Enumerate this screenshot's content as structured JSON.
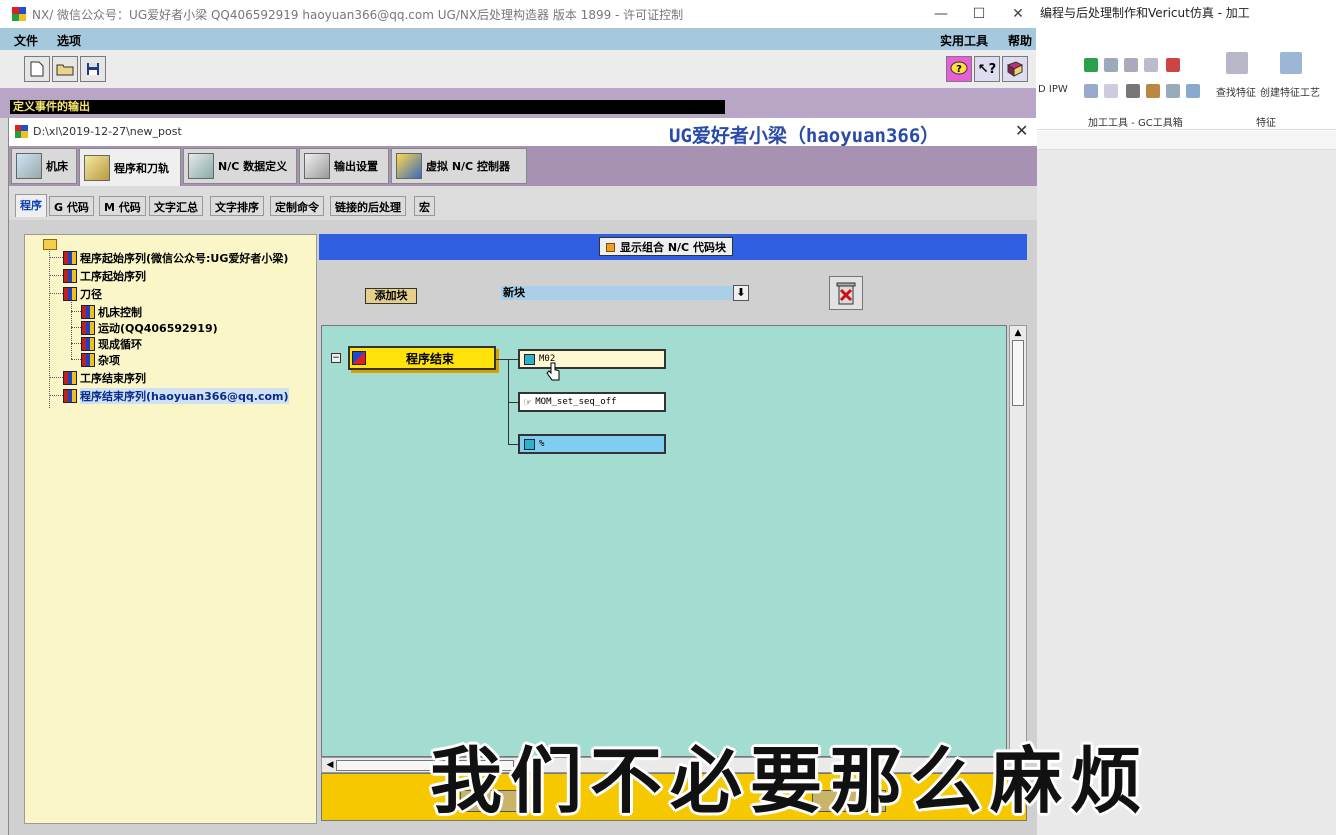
{
  "window": {
    "title": "NX/   微信公众号：UG爱好者小梁  QQ406592919  haoyuan366@qq.com  UG/NX后处理构造器 版本 1899 - 许可证控制",
    "min": "—",
    "max": "☐",
    "close": "✕"
  },
  "background_app": {
    "title": "编程与后处理制作和Vericut仿真 - 加工",
    "ipw_label": "D IPW",
    "group_label": "加工工具 - GC工具箱",
    "find_feature": "查找特征",
    "create_feature_process": "创建特征工艺",
    "feature_group": "特征"
  },
  "menu": {
    "file": "文件",
    "options": "选项",
    "utilities": "实用工具",
    "help": "帮助"
  },
  "status": {
    "text": "定义事件的输出"
  },
  "inner": {
    "path": "D:\\xl\\2019-12-27\\new_post",
    "watermark": "UG爱好者小梁（haoyuan366）",
    "close": "✕"
  },
  "main_tabs": [
    {
      "label": "机床"
    },
    {
      "label": "程序和刀轨"
    },
    {
      "label": "N/C 数据定义"
    },
    {
      "label": "输出设置"
    },
    {
      "label": "虚拟 N/C 控制器"
    }
  ],
  "sub_tabs": [
    {
      "label": "程序"
    },
    {
      "label": "G 代码"
    },
    {
      "label": "M 代码"
    },
    {
      "label": "文字汇总"
    },
    {
      "label": "文字排序"
    },
    {
      "label": "定制命令"
    },
    {
      "label": "链接的后处理"
    },
    {
      "label": "宏"
    }
  ],
  "tree": {
    "items": [
      {
        "label": "程序起始序列(微信公众号:UG爱好者小梁)"
      },
      {
        "label": "工序起始序列"
      },
      {
        "label": "刀径"
      },
      {
        "label": "机床控制"
      },
      {
        "label": "运动(QQ406592919)"
      },
      {
        "label": "现成循环"
      },
      {
        "label": "杂项"
      },
      {
        "label": "工序结束序列"
      },
      {
        "label": "程序结束序列(haoyuan366@qq.com)"
      }
    ]
  },
  "editor": {
    "combine_label": "显示组合 N/C 代码块",
    "add_block": "添加块",
    "new_block": "新块",
    "dropdown": "⬇",
    "trash": "🗑",
    "root_block": "程序结束",
    "blocks": [
      {
        "text": "M02"
      },
      {
        "text": "MOM_set_seq_off"
      },
      {
        "text": "%"
      }
    ],
    "collapse": "−"
  },
  "subtitle": "我们不必要那么麻烦",
  "colors": {
    "menu_bar": "#a6c8dc",
    "tabs_bar": "#a892b4",
    "tree_bg": "#fbf6c8",
    "editor_header": "#2f5fe0",
    "canvas_bg": "#a3ddd2",
    "root_block": "#ffe20a",
    "bottom_bar": "#f5c800"
  }
}
